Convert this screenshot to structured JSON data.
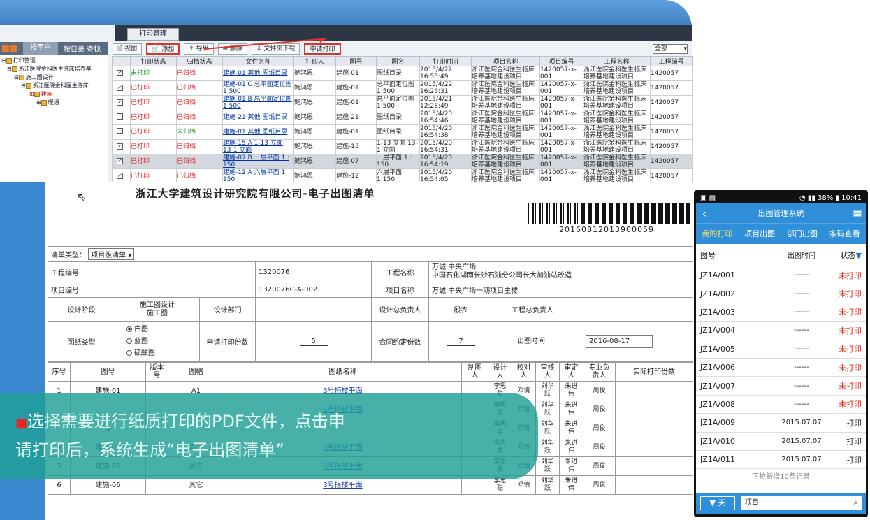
{
  "app": {
    "main_tab": "打印管理",
    "left_tabs": [
      "按用户",
      "按目录 查找"
    ],
    "tree": [
      "打印管理",
      "浙江医院金科医生临床培养基",
      "施工图设计",
      "浙江医院金科医生临床",
      "建筑",
      "暖通"
    ],
    "toolbar": [
      "视图",
      "添加",
      "导出",
      "删除",
      "文件夹下载",
      "申请打印"
    ],
    "filter_value": "全部",
    "columns": [
      "",
      "打印状态",
      "归档状态",
      "文件名称",
      "打印人",
      "图号",
      "图名",
      "打印时间",
      "项目名称",
      "项目编号",
      "工程名称",
      "工程编号"
    ],
    "rows": [
      {
        "checked": true,
        "print": "未打印",
        "archive": "已归档",
        "file": "建施-01 其他 图纸目录",
        "person": "鲍鸿恩",
        "no": "建施-01",
        "name": "图纸目录",
        "time": "2015/4/22 16:55:49",
        "project": "浙江医院金科医生临床培养基地建设项目",
        "pno": "1420057-x-001",
        "eng": "浙江医院金科医生临床培养基地建设项目",
        "eno": "1420057"
      },
      {
        "checked": true,
        "print": "已打印",
        "archive": "已归档",
        "file": "建施-01 C 总平面定位图 1 500",
        "person": "鲍鸿恩",
        "no": "建施-01",
        "name": "总平面定位图 1:500",
        "time": "2015/4/22 16:26:31",
        "project": "浙江医院金科医生临床培养基地建设项目",
        "pno": "1420057-x-001",
        "eng": "浙江医院金科医生临床培养基地建设项目",
        "eno": "1420057"
      },
      {
        "checked": true,
        "print": "已打印",
        "archive": "已归档",
        "file": "建施-01 B 总平面定位图 1 500",
        "person": "鲍鸿恩",
        "no": "建施-01",
        "name": "总平面定位图 1:500",
        "time": "2015/4/21 12:28:49",
        "project": "浙江医院金科医生临床培养基地建设项目",
        "pno": "1420057-x-001",
        "eng": "浙江医院金科医生临床培养基地建设项目",
        "eno": "1420057"
      },
      {
        "checked": false,
        "print": "已打印",
        "archive": "已归档",
        "file": "建施-21 其他 图纸目录",
        "person": "鲍鸿恩",
        "no": "建施-21",
        "name": "图纸目录",
        "time": "2015/4/20 16:54:46",
        "project": "浙江医院金科医生临床培养基地建设项目",
        "pno": "1420057-x-001",
        "eng": "浙江医院金科医生临床培养基地建设项目",
        "eno": "1420057"
      },
      {
        "checked": false,
        "print": "已打印",
        "archive": "未归档",
        "file": "建施-01 其他 图纸目录",
        "person": "鲍鸿恩",
        "no": "建施-01",
        "name": "图纸目录",
        "time": "2015/4/20 16:54:38",
        "project": "浙江医院金科医生临床培养基地建设项目",
        "pno": "1420057-x-001",
        "eng": "浙江医院金科医生临床培养基地建设项目",
        "eno": "1420057"
      },
      {
        "checked": true,
        "print": "已打印",
        "archive": "已归档",
        "file": "建施-15 A 1-13 立面 13-1 立面",
        "person": "鲍鸿恩",
        "no": "建施-15",
        "name": "1-13 立面 13-1 立面",
        "time": "2015/4/20 16:54:31",
        "project": "浙江医院金科医生临床培养基地建设项目",
        "pno": "1420057-x-001",
        "eng": "浙江医院金科医生临床培养基地建设项目",
        "eno": "1420057"
      },
      {
        "checked": true,
        "print": "已打印",
        "archive": "已归档",
        "file": "建施-07 B 一层平面 1 : 150",
        "person": "鲍鸿恩",
        "no": "建施-07",
        "name": "一层平面 1 : 150",
        "time": "2015/4/20 16:54:19",
        "project": "浙江医院金科医生临床培养基地建设项目",
        "pno": "1420057-x-001",
        "eng": "浙江医院金科医生临床培养基地建设项目",
        "eno": "1420057"
      },
      {
        "checked": true,
        "print": "已打印",
        "archive": "已归档",
        "file": "建施-12 A 六层平面 1 150",
        "person": "鲍鸿恩",
        "no": "建施-12",
        "name": "六层平面 1:150",
        "time": "2015/4/20 16:54:05",
        "project": "浙江医院金科医生临床培养基地建设项目",
        "pno": "1420057-x-001",
        "eng": "浙江医院金科医生临床培养基地建设项目",
        "eno": "1420057"
      }
    ]
  },
  "doc": {
    "title": "浙江大学建筑设计研究院有限公司-电子出图清单",
    "barcode_number": "20160812013900059",
    "list_type_label": "清单类型：",
    "list_type_value": "项目级清单",
    "eng_no_label": "工程编号",
    "eng_no": "1320076",
    "eng_name_label": "工程名称",
    "eng_name_1": "万诚·中央广场",
    "eng_name_2": "中国石化湖南长沙石油分公司长大加油站改造",
    "proj_no_label": "项目编号",
    "proj_no": "1320076C-A-002",
    "proj_name_label": "项目名称",
    "proj_name": "万诚·中央广场一期项目主楼",
    "stage_label": "设计阶段",
    "stage_value_1": "施工图设计",
    "stage_value_2": "施工图",
    "dept_label": "设计部门",
    "design_lead_label": "设计总负责人",
    "design_lead": "殷农",
    "eng_lead_label": "工程总负责人",
    "paper_type_label": "图纸类型",
    "paper_types": [
      "白图",
      "蓝图",
      "硫酸图"
    ],
    "req_copies_label": "申请打印份数",
    "req_copies": "5",
    "contract_copies_label": "合同约定份数",
    "contract_copies": "7",
    "out_time_label": "出图时间",
    "out_time": "2016-08-17",
    "list_headers": [
      "序号",
      "图号",
      "版本号",
      "图幅",
      "图纸名称",
      "制图人",
      "设计人",
      "校对人",
      "审核人",
      "审定人",
      "专业负责人",
      "实际打印份数"
    ],
    "list_rows": [
      {
        "seq": "1",
        "no": "建施-01",
        "size": "A1",
        "name": "3号搭楼平面",
        "design": "李思聪",
        "check": "邓倩",
        "review": "刘华跃",
        "approve": "朱进伟",
        "lead": "周俊"
      },
      {
        "seq": "",
        "no": "",
        "size": "",
        "name": "3号搭楼平面",
        "design": "李思聪",
        "check": "邓倩",
        "review": "刘华跃",
        "approve": "朱进伟",
        "lead": "周俊"
      },
      {
        "seq": "",
        "no": "3",
        "size": "",
        "name": "",
        "design": "李思聪",
        "check": "邓倩",
        "review": "刘华跃",
        "approve": "朱进伟",
        "lead": "周俊"
      },
      {
        "seq": "4",
        "no": "建施-04",
        "size": "其它",
        "name": "3号搭楼平面",
        "design": "李思聪",
        "check": "邓倩",
        "review": "刘华跃",
        "approve": "朱进伟",
        "lead": "周俊"
      },
      {
        "seq": "5",
        "no": "建施-05",
        "size": "其它",
        "name": "3号搭楼平面",
        "design": "李思聪",
        "check": "邓倩",
        "review": "刘华跃",
        "approve": "朱进伟",
        "lead": "周俊"
      },
      {
        "seq": "6",
        "no": "建施-06",
        "size": "其它",
        "name": "3号搭楼平面",
        "design": "李思聪",
        "check": "邓倩",
        "review": "刘华跃",
        "approve": "朱进伟",
        "lead": "周俊"
      }
    ]
  },
  "overlay": {
    "line1": "选择需要进行纸质打印的PDF文件，点击申",
    "line2": "请打印后，系统生成“电子出图清单”"
  },
  "phone": {
    "time": "10:41",
    "battery": "38%",
    "title": "出图管理系统",
    "tabs": [
      "我的打印",
      "项目出图",
      "部门出图",
      "条码查看"
    ],
    "head": {
      "no": "图号",
      "time": "出图时间",
      "status": "状态"
    },
    "rows": [
      {
        "no": "JZ1A/001",
        "time": "------",
        "status": "未打印",
        "red": true
      },
      {
        "no": "JZ1A/002",
        "time": "------",
        "status": "未打印",
        "red": true
      },
      {
        "no": "JZ1A/003",
        "time": "------",
        "status": "未打印",
        "red": true
      },
      {
        "no": "JZ1A/004",
        "time": "------",
        "status": "未打印",
        "red": true
      },
      {
        "no": "JZ1A/005",
        "time": "------",
        "status": "未打印",
        "red": true
      },
      {
        "no": "JZ1A/006",
        "time": "------",
        "status": "未打印",
        "red": true
      },
      {
        "no": "JZ1A/007",
        "time": "------",
        "status": "未打印",
        "red": true
      },
      {
        "no": "JZ1A/008",
        "time": "------",
        "status": "未打印",
        "red": true
      },
      {
        "no": "JZ1A/009",
        "time": "2015.07.07",
        "status": "打印",
        "red": false
      },
      {
        "no": "JZ1A/010",
        "time": "2015.07.07",
        "status": "打印",
        "red": false
      },
      {
        "no": "JZ1A/011",
        "time": "2015.07.07",
        "status": "打印",
        "red": false
      }
    ],
    "more": "下拉新增10条记录",
    "dropdown": "天",
    "search_placeholder": "项目"
  }
}
